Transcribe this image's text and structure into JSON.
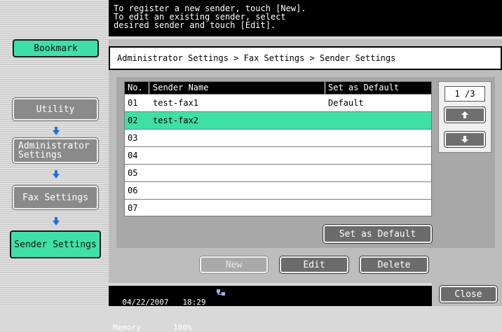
{
  "left_nav": {
    "bookmark": "Bookmark",
    "utility": "Utility",
    "administrator_settings": "Administrator Settings",
    "fax_settings": "Fax Settings",
    "sender_settings": "Sender Settings"
  },
  "message": "To register a new sender, touch [New].\nTo edit an existing sender, select\ndesired sender and touch [Edit].",
  "breadcrumb": "Administrator Settings > Fax Settings > Sender Settings",
  "table": {
    "headers": {
      "no": "No.",
      "name": "Sender Name",
      "default": "Set as Default"
    },
    "rows": [
      {
        "no": "01",
        "name": "test-fax1",
        "default": "Default",
        "selected": false
      },
      {
        "no": "02",
        "name": "test-fax2",
        "default": "",
        "selected": true
      },
      {
        "no": "03",
        "name": "",
        "default": "",
        "selected": false
      },
      {
        "no": "04",
        "name": "",
        "default": "",
        "selected": false
      },
      {
        "no": "05",
        "name": "",
        "default": "",
        "selected": false
      },
      {
        "no": "06",
        "name": "",
        "default": "",
        "selected": false
      },
      {
        "no": "07",
        "name": "",
        "default": "",
        "selected": false
      }
    ]
  },
  "pager": {
    "page": "1 /3",
    "up_icon": "arrow-up-icon",
    "down_icon": "arrow-down-icon"
  },
  "buttons": {
    "set_as_default": "Set as Default",
    "new": "New",
    "edit": "Edit",
    "delete": "Delete",
    "close": "Close"
  },
  "status": {
    "line1": "04/22/2007   18:29",
    "line2": "Memory       100%",
    "icon": "network-icon"
  },
  "colors": {
    "accent": "#3fe0a8",
    "arrow": "#1f6fe0"
  }
}
